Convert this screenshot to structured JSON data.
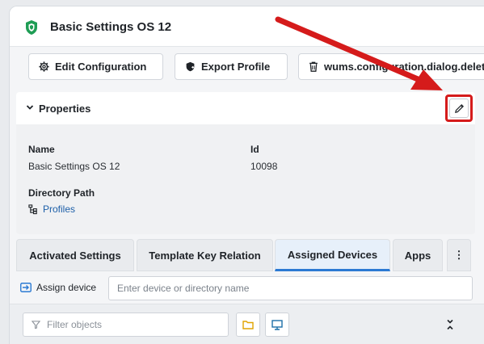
{
  "header": {
    "title": "Basic Settings OS 12",
    "icon": "shield-icon"
  },
  "toolbar": {
    "edit_configuration": "Edit Configuration",
    "export_profile": "Export Profile",
    "delete": "wums.configuration.dialog.delete"
  },
  "properties": {
    "title": "Properties",
    "name_label": "Name",
    "name_value": "Basic Settings OS 12",
    "id_label": "Id",
    "id_value": "10098",
    "directory_label": "Directory Path",
    "directory_value": "Profiles"
  },
  "tabs": [
    {
      "label": "Activated Settings"
    },
    {
      "label": "Template Key Relation"
    },
    {
      "label": "Assigned Devices",
      "active": true
    },
    {
      "label": "Apps"
    }
  ],
  "tabs_more": "⋮",
  "assign": {
    "label": "Assign device",
    "placeholder": "Enter device or directory name"
  },
  "filter": {
    "placeholder": "Filter objects"
  },
  "colors": {
    "accent": "#2b7ad3",
    "shield": "#1f9d55",
    "annotation": "#d51b1b",
    "link": "#1d5fa8",
    "folder": "#e0a400"
  }
}
